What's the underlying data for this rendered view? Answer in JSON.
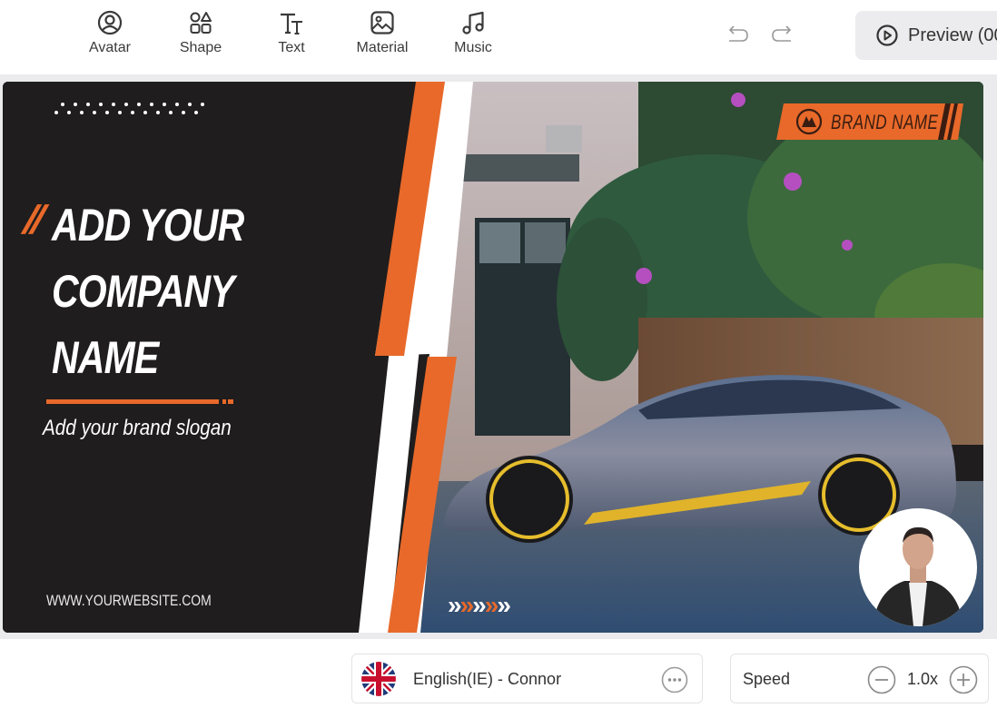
{
  "toolbar": {
    "tools": [
      {
        "label": "Avatar",
        "icon": "avatar-icon"
      },
      {
        "label": "Shape",
        "icon": "shape-icon"
      },
      {
        "label": "Text",
        "icon": "text-icon"
      },
      {
        "label": "Material",
        "icon": "image-icon"
      },
      {
        "label": "Music",
        "icon": "music-note-icon"
      }
    ],
    "undo_icon": "undo-icon",
    "redo_icon": "redo-icon",
    "preview_label": "Preview (00",
    "preview_icon": "play-circle-icon"
  },
  "canvas": {
    "headline": [
      "ADD YOUR",
      "COMPANY",
      "NAME"
    ],
    "quote_mark": "//",
    "slogan": "Add your brand slogan",
    "website": "WWW.YOURWEBSITE.COM",
    "brand_name": "BRAND NAME",
    "brand_icon": "mountain-logo-icon",
    "chevrons": [
      "»",
      "»",
      "»",
      "»",
      "»"
    ],
    "chevron_colors": [
      "#ffffff",
      "#e8692a",
      "#ffffff",
      "#e8692a",
      "#ffffff"
    ],
    "background_photo": "car-street-photo",
    "presenter": "avatar-presenter"
  },
  "voice": {
    "flag_icon": "uk-flag-icon",
    "label": "English(IE) - Connor",
    "more_icon": "more-options-icon"
  },
  "speed": {
    "label": "Speed",
    "value": "1.0x"
  },
  "colors": {
    "accent_orange": "#e8692a",
    "panel_dark": "#1f1d1d",
    "brand_text": "#3a1d12"
  }
}
